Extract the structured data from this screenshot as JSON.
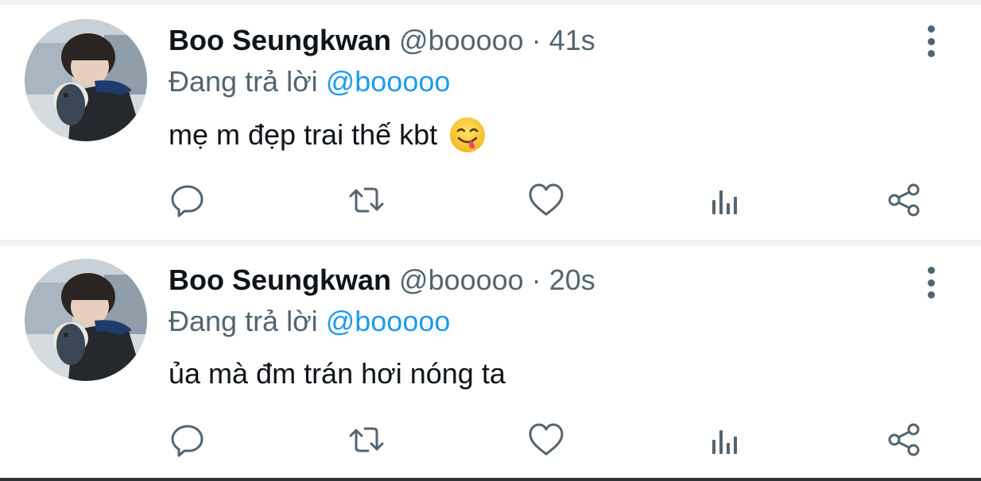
{
  "tweets": [
    {
      "name": "Boo Seungkwan",
      "handle": "@booooo",
      "separator": "·",
      "time": "41s",
      "reply_prefix": "Đang trả lời",
      "reply_to": "@booooo",
      "text": "mẹ m đẹp trai thế kbt",
      "emoji": "face-savoring-food"
    },
    {
      "name": "Boo Seungkwan",
      "handle": "@booooo",
      "separator": "·",
      "time": "20s",
      "reply_prefix": "Đang trả lời",
      "reply_to": "@booooo",
      "text": "ủa mà đm trán hơi nóng ta"
    }
  ],
  "icons": {
    "reply": "reply-icon",
    "retweet": "retweet-icon",
    "like": "heart-icon",
    "views": "analytics-icon",
    "share": "share-icon",
    "more": "more-vertical-icon"
  },
  "colors": {
    "text": "#0f1419",
    "secondary": "#536471",
    "link": "#1d9bf0",
    "divider": "#eff1f3"
  }
}
